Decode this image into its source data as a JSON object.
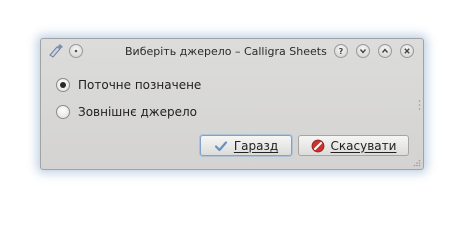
{
  "window": {
    "title": "Виберіть джерело – Calligra Sheets"
  },
  "titlebar_buttons": [
    "help-icon",
    "minimize-icon",
    "maximize-icon",
    "close-icon"
  ],
  "options": [
    {
      "label": "Поточне позначене",
      "selected": true
    },
    {
      "label": "Зовнішнє джерело",
      "selected": false
    }
  ],
  "buttons": {
    "ok": {
      "label": "Гаразд",
      "icon": "checkmark-icon"
    },
    "cancel": {
      "label": "Скасувати",
      "icon": "cancel-icon"
    }
  },
  "colors": {
    "window_bg": "#d6d5d3",
    "default_button_border": "#7fa4cc",
    "cancel_icon": "#c8342b"
  }
}
